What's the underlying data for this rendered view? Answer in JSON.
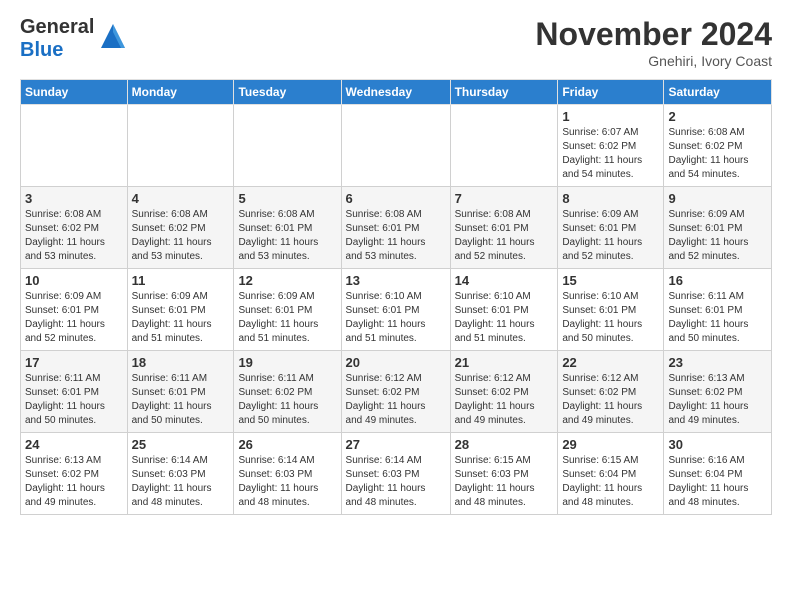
{
  "header": {
    "logo_line1": "General",
    "logo_line2": "Blue",
    "month": "November 2024",
    "location": "Gnehiri, Ivory Coast"
  },
  "weekdays": [
    "Sunday",
    "Monday",
    "Tuesday",
    "Wednesday",
    "Thursday",
    "Friday",
    "Saturday"
  ],
  "weeks": [
    [
      {
        "day": "",
        "info": ""
      },
      {
        "day": "",
        "info": ""
      },
      {
        "day": "",
        "info": ""
      },
      {
        "day": "",
        "info": ""
      },
      {
        "day": "",
        "info": ""
      },
      {
        "day": "1",
        "info": "Sunrise: 6:07 AM\nSunset: 6:02 PM\nDaylight: 11 hours\nand 54 minutes."
      },
      {
        "day": "2",
        "info": "Sunrise: 6:08 AM\nSunset: 6:02 PM\nDaylight: 11 hours\nand 54 minutes."
      }
    ],
    [
      {
        "day": "3",
        "info": "Sunrise: 6:08 AM\nSunset: 6:02 PM\nDaylight: 11 hours\nand 53 minutes."
      },
      {
        "day": "4",
        "info": "Sunrise: 6:08 AM\nSunset: 6:02 PM\nDaylight: 11 hours\nand 53 minutes."
      },
      {
        "day": "5",
        "info": "Sunrise: 6:08 AM\nSunset: 6:01 PM\nDaylight: 11 hours\nand 53 minutes."
      },
      {
        "day": "6",
        "info": "Sunrise: 6:08 AM\nSunset: 6:01 PM\nDaylight: 11 hours\nand 53 minutes."
      },
      {
        "day": "7",
        "info": "Sunrise: 6:08 AM\nSunset: 6:01 PM\nDaylight: 11 hours\nand 52 minutes."
      },
      {
        "day": "8",
        "info": "Sunrise: 6:09 AM\nSunset: 6:01 PM\nDaylight: 11 hours\nand 52 minutes."
      },
      {
        "day": "9",
        "info": "Sunrise: 6:09 AM\nSunset: 6:01 PM\nDaylight: 11 hours\nand 52 minutes."
      }
    ],
    [
      {
        "day": "10",
        "info": "Sunrise: 6:09 AM\nSunset: 6:01 PM\nDaylight: 11 hours\nand 52 minutes."
      },
      {
        "day": "11",
        "info": "Sunrise: 6:09 AM\nSunset: 6:01 PM\nDaylight: 11 hours\nand 51 minutes."
      },
      {
        "day": "12",
        "info": "Sunrise: 6:09 AM\nSunset: 6:01 PM\nDaylight: 11 hours\nand 51 minutes."
      },
      {
        "day": "13",
        "info": "Sunrise: 6:10 AM\nSunset: 6:01 PM\nDaylight: 11 hours\nand 51 minutes."
      },
      {
        "day": "14",
        "info": "Sunrise: 6:10 AM\nSunset: 6:01 PM\nDaylight: 11 hours\nand 51 minutes."
      },
      {
        "day": "15",
        "info": "Sunrise: 6:10 AM\nSunset: 6:01 PM\nDaylight: 11 hours\nand 50 minutes."
      },
      {
        "day": "16",
        "info": "Sunrise: 6:11 AM\nSunset: 6:01 PM\nDaylight: 11 hours\nand 50 minutes."
      }
    ],
    [
      {
        "day": "17",
        "info": "Sunrise: 6:11 AM\nSunset: 6:01 PM\nDaylight: 11 hours\nand 50 minutes."
      },
      {
        "day": "18",
        "info": "Sunrise: 6:11 AM\nSunset: 6:01 PM\nDaylight: 11 hours\nand 50 minutes."
      },
      {
        "day": "19",
        "info": "Sunrise: 6:11 AM\nSunset: 6:02 PM\nDaylight: 11 hours\nand 50 minutes."
      },
      {
        "day": "20",
        "info": "Sunrise: 6:12 AM\nSunset: 6:02 PM\nDaylight: 11 hours\nand 49 minutes."
      },
      {
        "day": "21",
        "info": "Sunrise: 6:12 AM\nSunset: 6:02 PM\nDaylight: 11 hours\nand 49 minutes."
      },
      {
        "day": "22",
        "info": "Sunrise: 6:12 AM\nSunset: 6:02 PM\nDaylight: 11 hours\nand 49 minutes."
      },
      {
        "day": "23",
        "info": "Sunrise: 6:13 AM\nSunset: 6:02 PM\nDaylight: 11 hours\nand 49 minutes."
      }
    ],
    [
      {
        "day": "24",
        "info": "Sunrise: 6:13 AM\nSunset: 6:02 PM\nDaylight: 11 hours\nand 49 minutes."
      },
      {
        "day": "25",
        "info": "Sunrise: 6:14 AM\nSunset: 6:03 PM\nDaylight: 11 hours\nand 48 minutes."
      },
      {
        "day": "26",
        "info": "Sunrise: 6:14 AM\nSunset: 6:03 PM\nDaylight: 11 hours\nand 48 minutes."
      },
      {
        "day": "27",
        "info": "Sunrise: 6:14 AM\nSunset: 6:03 PM\nDaylight: 11 hours\nand 48 minutes."
      },
      {
        "day": "28",
        "info": "Sunrise: 6:15 AM\nSunset: 6:03 PM\nDaylight: 11 hours\nand 48 minutes."
      },
      {
        "day": "29",
        "info": "Sunrise: 6:15 AM\nSunset: 6:04 PM\nDaylight: 11 hours\nand 48 minutes."
      },
      {
        "day": "30",
        "info": "Sunrise: 6:16 AM\nSunset: 6:04 PM\nDaylight: 11 hours\nand 48 minutes."
      }
    ]
  ]
}
